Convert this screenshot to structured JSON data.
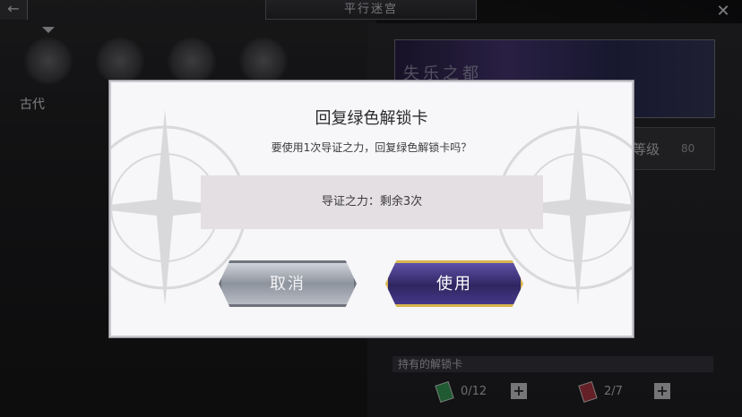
{
  "header": {
    "title": "平行迷宫",
    "back_icon": "arrow-left-icon",
    "close_icon": "close-icon"
  },
  "eras": {
    "selected_label": "古代"
  },
  "right_panel": {
    "banner_title": "失乐之都",
    "level_label": "等级",
    "level_value": "80",
    "owned_label": "持有的解锁卡",
    "green_count": "0/12",
    "red_count": "2/7",
    "plus": "+"
  },
  "dialog": {
    "title": "回复绿色解锁卡",
    "message": "要使用1次导证之力，回复绿色解锁卡吗？",
    "info": "导证之力：剩余3次",
    "cancel_label": "取消",
    "use_label": "使用"
  },
  "colors": {
    "use_border": "#d7b54f",
    "green_card": "#3aa55a",
    "red_card": "#b73a48"
  }
}
